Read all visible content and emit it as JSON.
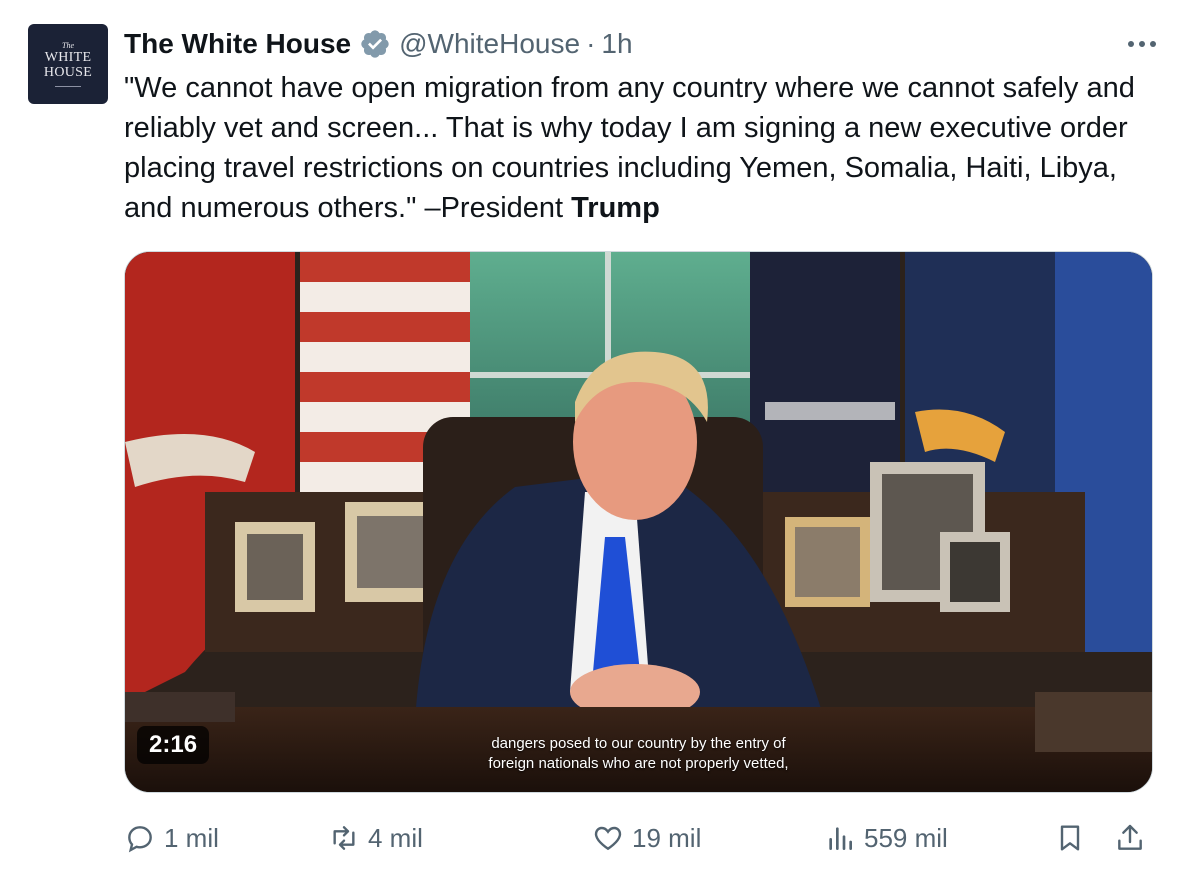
{
  "account": {
    "avatar_lines": [
      "The",
      "WHITE",
      "HOUSE"
    ],
    "display_name": "The White House",
    "handle": "@WhiteHouse",
    "separator": "·",
    "time": "1h",
    "verified": true,
    "verified_color": "#829aab"
  },
  "tweet": {
    "text": "\"We cannot have open migration from any country where we cannot safely and reliably vet and screen... That is why today I am signing a new executive order placing travel restrictions on countries including Yemen, Somalia, Haiti, Libya, and numerous others.\" –President ",
    "bold_tail": "Trump"
  },
  "video": {
    "duration": "2:16",
    "caption_line1": "dangers posed to our country by the entry of",
    "caption_line2": "foreign nationals who are not properly vetted,"
  },
  "actions": {
    "replies": "1 mil",
    "reposts": "4 mil",
    "likes": "19 mil",
    "views": "559 mil"
  },
  "icons": {
    "more": "more-icon",
    "reply": "reply-icon",
    "repost": "repost-icon",
    "like": "heart-icon",
    "views": "views-icon",
    "bookmark": "bookmark-icon",
    "share": "share-icon"
  },
  "colors": {
    "text_primary": "#0f1419",
    "text_secondary": "#536471",
    "avatar_bg": "#1b2236"
  }
}
